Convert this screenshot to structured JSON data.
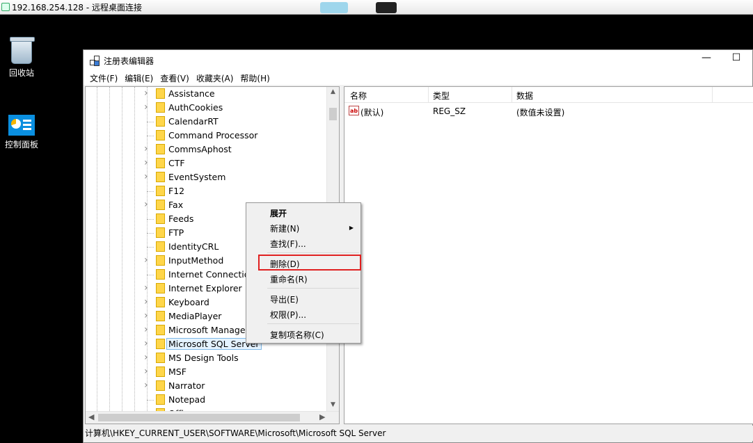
{
  "rdp": {
    "title": "192.168.254.128 - 远程桌面连接"
  },
  "desktop": {
    "icons": [
      {
        "label": "回收站",
        "icon": "recycle-bin-icon"
      },
      {
        "label": "控制面板",
        "icon": "control-panel-icon"
      }
    ]
  },
  "window": {
    "title": "注册表编辑器",
    "minimize": "—",
    "maximize": "☐"
  },
  "menu": [
    "文件(F)",
    "编辑(E)",
    "查看(V)",
    "收藏夹(A)",
    "帮助(H)"
  ],
  "tree": {
    "nodes": [
      {
        "label": "Assistance",
        "expandable": true
      },
      {
        "label": "AuthCookies",
        "expandable": true
      },
      {
        "label": "CalendarRT",
        "expandable": false
      },
      {
        "label": "Command Processor",
        "expandable": false
      },
      {
        "label": "CommsAphost",
        "expandable": true
      },
      {
        "label": "CTF",
        "expandable": true
      },
      {
        "label": "EventSystem",
        "expandable": true
      },
      {
        "label": "F12",
        "expandable": false
      },
      {
        "label": "Fax",
        "expandable": true
      },
      {
        "label": "Feeds",
        "expandable": false
      },
      {
        "label": "FTP",
        "expandable": false
      },
      {
        "label": "IdentityCRL",
        "expandable": false
      },
      {
        "label": "InputMethod",
        "expandable": true
      },
      {
        "label": "Internet Connection",
        "expandable": false
      },
      {
        "label": "Internet Explorer",
        "expandable": true
      },
      {
        "label": "Keyboard",
        "expandable": true
      },
      {
        "label": "MediaPlayer",
        "expandable": true
      },
      {
        "label": "Microsoft Manager",
        "expandable": true
      },
      {
        "label": "Microsoft SQL Server",
        "expandable": true,
        "selected": true
      },
      {
        "label": "MS Design Tools",
        "expandable": true
      },
      {
        "label": "MSF",
        "expandable": true
      },
      {
        "label": "Narrator",
        "expandable": true
      },
      {
        "label": "Notepad",
        "expandable": false
      },
      {
        "label": "Offi",
        "expandable": true
      }
    ]
  },
  "values": {
    "columns": [
      "名称",
      "类型",
      "数据"
    ],
    "rows": [
      {
        "name": "(默认)",
        "type": "REG_SZ",
        "data": "(数值未设置)",
        "icon": "ab"
      }
    ]
  },
  "context_menu": {
    "items": [
      "展开",
      "新建(N)",
      "查找(F)...",
      "删除(D)",
      "重命名(R)",
      "导出(E)",
      "权限(P)...",
      "复制项名称(C)"
    ]
  },
  "status": {
    "path": "计算机\\HKEY_CURRENT_USER\\SOFTWARE\\Microsoft\\Microsoft SQL Server"
  },
  "colors": {
    "highlight": "#e02020",
    "selection": "#e5f3ff",
    "folder": "#ffd64a"
  }
}
